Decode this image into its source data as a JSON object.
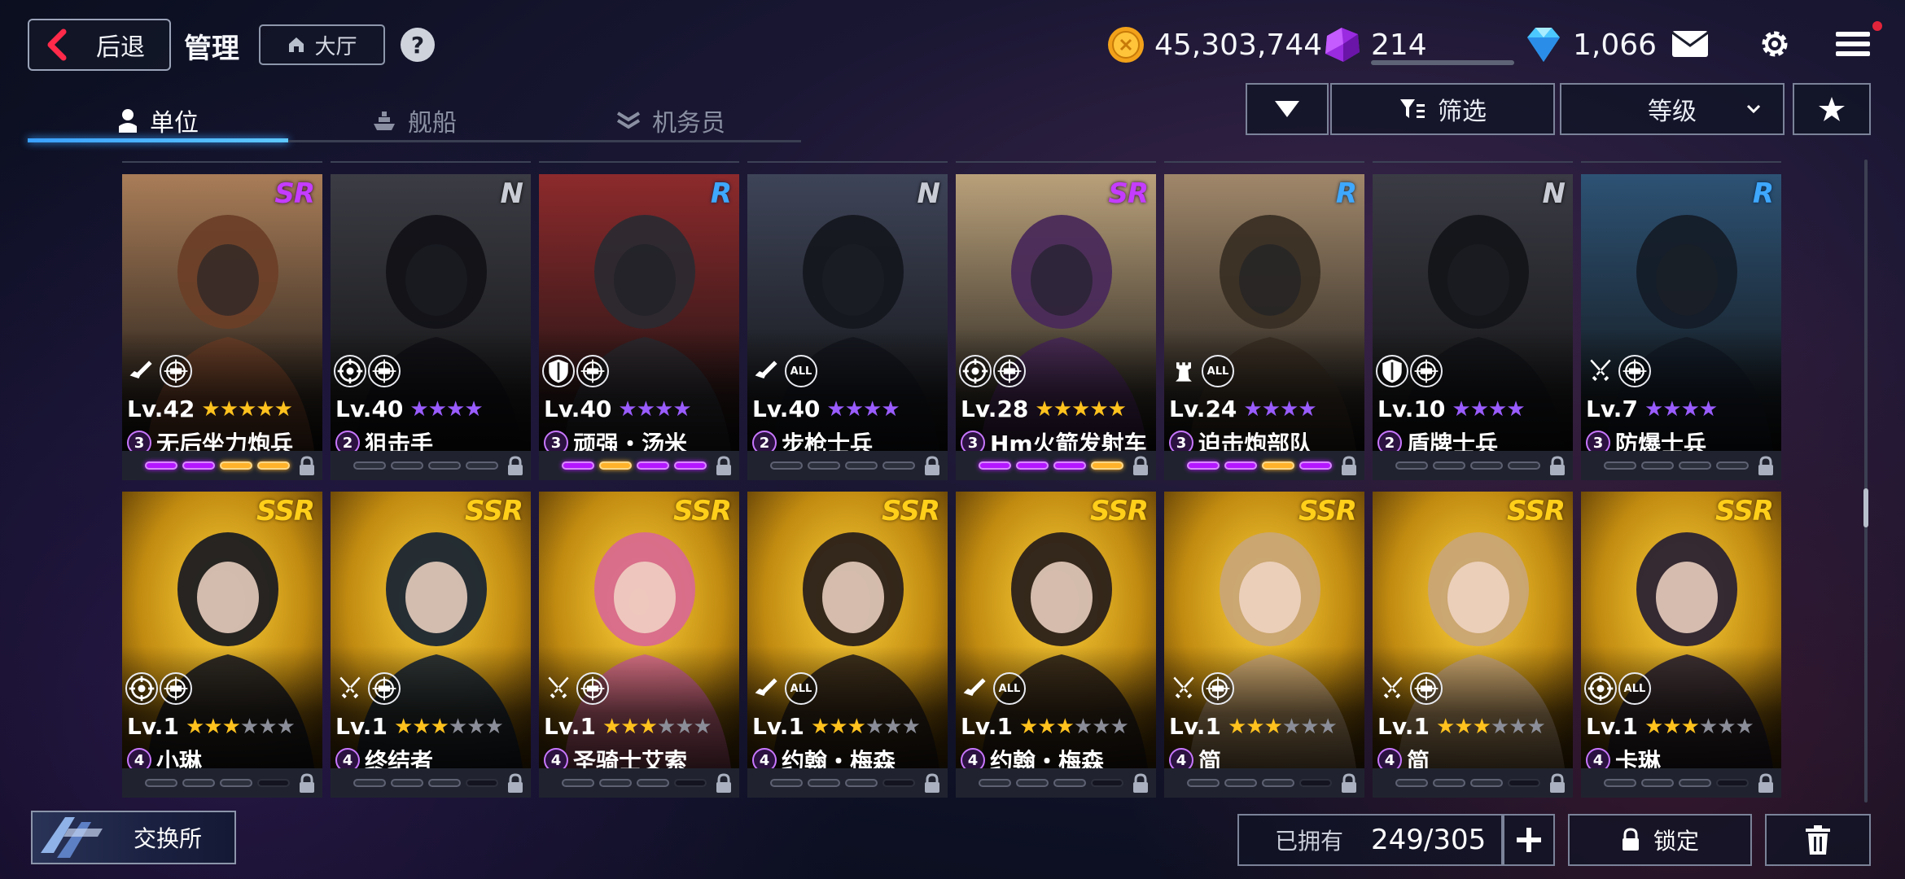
{
  "header": {
    "back_label": "后退",
    "title": "管理",
    "lobby_label": "大厅",
    "help_icon": "?"
  },
  "resources": {
    "gold": "45,303,744",
    "crystal": "214",
    "diamond": "1,066"
  },
  "tabs": [
    {
      "label": "单位",
      "icon": "person-icon",
      "active": true
    },
    {
      "label": "舰船",
      "icon": "ship-icon",
      "active": false
    },
    {
      "label": "机务员",
      "icon": "chevrons-icon",
      "active": false
    }
  ],
  "filters": {
    "filter_label": "筛选",
    "sort_label": "等级"
  },
  "units": [
    {
      "rarity": "SR",
      "level": "Lv.42",
      "stars": 5,
      "max_stars": 5,
      "star_color": "gold",
      "rank": "3",
      "name": "无后坐力炮兵",
      "icons": [
        "rifle-icon",
        "crosshair-badge-icon"
      ],
      "slots": [
        "p",
        "p",
        "y",
        "y"
      ],
      "art": "#7a4f35"
    },
    {
      "rarity": "N",
      "level": "Lv.40",
      "stars": 4,
      "max_stars": 4,
      "star_color": "purple",
      "rank": "2",
      "name": "狙击手",
      "icons": [
        "target-icon",
        "crosshair-badge-icon"
      ],
      "slots": [
        "",
        "",
        "",
        ""
      ],
      "art": "#2a2a30"
    },
    {
      "rarity": "R",
      "level": "Lv.40",
      "stars": 4,
      "max_stars": 4,
      "star_color": "purple",
      "rank": "3",
      "name": "顽强・汤米",
      "icons": [
        "shield-icon",
        "crosshair-badge-icon"
      ],
      "slots": [
        "p",
        "y",
        "p",
        "p"
      ],
      "art": "#6a1e22"
    },
    {
      "rarity": "N",
      "level": "Lv.40",
      "stars": 4,
      "max_stars": 4,
      "star_color": "purple",
      "rank": "2",
      "name": "步枪士兵",
      "icons": [
        "rifle-icon",
        "all-icon"
      ],
      "slots": [
        "",
        "",
        "",
        ""
      ],
      "art": "#2c3040"
    },
    {
      "rarity": "SR",
      "level": "Lv.28",
      "stars": 5,
      "max_stars": 5,
      "star_color": "gold",
      "rank": "3",
      "name": "Hm火箭发射车",
      "icons": [
        "target-icon",
        "crosshair-badge-icon"
      ],
      "slots": [
        "p",
        "p",
        "p",
        "y"
      ],
      "art": "#4a2a5a"
    },
    {
      "rarity": "R",
      "level": "Lv.24",
      "stars": 4,
      "max_stars": 4,
      "star_color": "purple",
      "rank": "3",
      "name": "迫击炮部队",
      "icons": [
        "rook-icon",
        "all-icon"
      ],
      "slots": [
        "p",
        "p",
        "y",
        "p"
      ],
      "art": "#6b5a42"
    },
    {
      "rarity": "N",
      "level": "Lv.10",
      "stars": 4,
      "max_stars": 4,
      "star_color": "purple",
      "rank": "2",
      "name": "盾牌士兵",
      "icons": [
        "shield-icon",
        "crosshair-badge-icon"
      ],
      "slots": [
        "",
        "",
        "",
        ""
      ],
      "art": "#2a2b33"
    },
    {
      "rarity": "R",
      "level": "Lv.7",
      "stars": 4,
      "max_stars": 4,
      "star_color": "purple",
      "rank": "3",
      "name": "防爆士兵",
      "icons": [
        "crossed-swords-icon",
        "crosshair-badge-icon"
      ],
      "slots": [
        "",
        "",
        "",
        ""
      ],
      "art": "#1f3850"
    },
    {
      "rarity": "SSR",
      "level": "Lv.1",
      "stars": 3,
      "max_stars": 6,
      "star_color": "gold",
      "rank": "4",
      "name": "小琳",
      "icons": [
        "target-icon",
        "crosshair-badge-icon"
      ],
      "slots": [
        "",
        "",
        "",
        "dk"
      ],
      "art": "#3a2a10"
    },
    {
      "rarity": "SSR",
      "level": "Lv.1",
      "stars": 3,
      "max_stars": 6,
      "star_color": "gold",
      "rank": "4",
      "name": "终结者",
      "icons": [
        "crossed-swords-icon",
        "crosshair-badge-icon"
      ],
      "slots": [
        "",
        "",
        "",
        "dk"
      ],
      "art": "#1e2c3c"
    },
    {
      "rarity": "SSR",
      "level": "Lv.1",
      "stars": 3,
      "max_stars": 6,
      "star_color": "gold",
      "rank": "4",
      "name": "圣骑士艾索",
      "icons": [
        "crossed-swords-icon",
        "crosshair-badge-icon"
      ],
      "slots": [
        "",
        "",
        "",
        "dk"
      ],
      "art": "#b04870"
    },
    {
      "rarity": "SSR",
      "level": "Lv.1",
      "stars": 3,
      "max_stars": 6,
      "star_color": "gold",
      "rank": "4",
      "name": "约翰・梅森",
      "icons": [
        "rifle-icon",
        "all-icon"
      ],
      "slots": [
        "",
        "",
        "",
        "dk"
      ],
      "art": "#3a2a14"
    },
    {
      "rarity": "SSR",
      "level": "Lv.1",
      "stars": 3,
      "max_stars": 6,
      "star_color": "gold",
      "rank": "4",
      "name": "约翰・梅森",
      "icons": [
        "rifle-icon",
        "all-icon"
      ],
      "slots": [
        "",
        "",
        "",
        "dk"
      ],
      "art": "#3a2a14"
    },
    {
      "rarity": "SSR",
      "level": "Lv.1",
      "stars": 3,
      "max_stars": 6,
      "star_color": "gold",
      "rank": "4",
      "name": "简",
      "icons": [
        "crossed-swords-icon",
        "crosshair-badge-icon"
      ],
      "slots": [
        "",
        "",
        "",
        "dk"
      ],
      "art": "#8a6a3a"
    },
    {
      "rarity": "SSR",
      "level": "Lv.1",
      "stars": 3,
      "max_stars": 6,
      "star_color": "gold",
      "rank": "4",
      "name": "简",
      "icons": [
        "crossed-swords-icon",
        "crosshair-badge-icon"
      ],
      "slots": [
        "",
        "",
        "",
        "dk"
      ],
      "art": "#8a6a3a"
    },
    {
      "rarity": "SSR",
      "level": "Lv.1",
      "stars": 3,
      "max_stars": 6,
      "star_color": "gold",
      "rank": "4",
      "name": "卡琳",
      "icons": [
        "target-icon",
        "all-icon"
      ],
      "slots": [
        "",
        "",
        "",
        "dk"
      ],
      "art": "#2a2030"
    }
  ],
  "bottom": {
    "exchange_label": "交换所",
    "owned_label": "已拥有",
    "owned_value": "249/305",
    "lock_label": "锁定"
  },
  "colors": {
    "accent_blue": "#3aa0ff",
    "sr_purple": "#c43cff",
    "ssr_gold": "#ffcf1a",
    "r_blue": "#3ea8ff"
  }
}
